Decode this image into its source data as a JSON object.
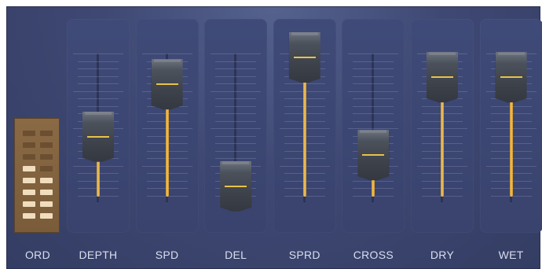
{
  "colors": {
    "panel": "#3e4873",
    "accent": "#f3c45b",
    "ord_block": "#7a5c3a"
  },
  "ord_selector": {
    "label": "ORD",
    "filled_cells": 9,
    "total_cells": 16
  },
  "faders": [
    {
      "id": "depth",
      "label": "DEPTH",
      "value": 0.44
    },
    {
      "id": "spd",
      "label": "SPD",
      "value": 0.81
    },
    {
      "id": "del",
      "label": "DEL",
      "value": 0.09
    },
    {
      "id": "sprd",
      "label": "SPRD",
      "value": 1.0
    },
    {
      "id": "cross",
      "label": "CROSS",
      "value": 0.31
    },
    {
      "id": "dry",
      "label": "DRY",
      "value": 0.86
    },
    {
      "id": "wet",
      "label": "WET",
      "value": 0.86
    }
  ]
}
